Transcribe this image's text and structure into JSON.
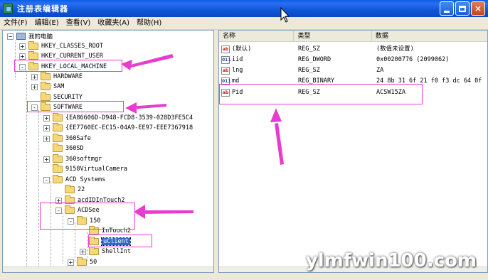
{
  "window": {
    "title": "注册表编辑器",
    "buttons": {
      "minimize": "",
      "maximize": "",
      "close": "×"
    }
  },
  "menu": [
    {
      "label": "文件(F)"
    },
    {
      "label": "编辑(E)"
    },
    {
      "label": "查看(V)"
    },
    {
      "label": "收藏夹(A)"
    },
    {
      "label": "帮助(H)"
    }
  ],
  "tree": {
    "root": "我的电脑",
    "nodes": [
      {
        "label": "HKEY_CLASSES_ROOT",
        "expander": "+"
      },
      {
        "label": "HKEY_CURRENT_USER",
        "expander": "+"
      },
      {
        "label": "HKEY_LOCAL_MACHINE",
        "expander": "-"
      },
      {
        "label": "HARDWARE",
        "expander": "+"
      },
      {
        "label": "SAM",
        "expander": "+"
      },
      {
        "label": "SECURITY",
        "expander": ""
      },
      {
        "label": "SOFTWARE",
        "expander": "-"
      },
      {
        "label": "{EA86606D-D948-FCD8-3539-028D3FE5C4",
        "expander": "+"
      },
      {
        "label": "{EE7760EC-EC15-04A9-EE97-EEE7367918",
        "expander": "+"
      },
      {
        "label": "360Safe",
        "expander": "+"
      },
      {
        "label": "360SD",
        "expander": ""
      },
      {
        "label": "360softmgr",
        "expander": "+"
      },
      {
        "label": "9158VirtualCamera",
        "expander": ""
      },
      {
        "label": "ACD Systems",
        "expander": "-"
      },
      {
        "label": "22",
        "expander": ""
      },
      {
        "label": "acdIDInTouch2",
        "expander": "+"
      },
      {
        "label": "ACDSee",
        "expander": "-"
      },
      {
        "label": "150",
        "expander": "-"
      },
      {
        "label": "InTouch2",
        "expander": ""
      },
      {
        "label": "uClient",
        "expander": ""
      },
      {
        "label": "ShellInt",
        "expander": "+"
      },
      {
        "label": "50",
        "expander": "+"
      }
    ]
  },
  "list": {
    "headers": {
      "name": "名称",
      "type": "类型",
      "data": "数据"
    },
    "rows": [
      {
        "icon": "ab",
        "name": "(默认)",
        "type": "REG_SZ",
        "data": "(数值未设置)"
      },
      {
        "icon": "011",
        "name": "iid",
        "type": "REG_DWORD",
        "data": "0x00200776 (2099062)"
      },
      {
        "icon": "ab",
        "name": "lng",
        "type": "REG_SZ",
        "data": "ZA"
      },
      {
        "icon": "011",
        "name": "md",
        "type": "REG_BINARY",
        "data": "24 8b 31 6f 21 f0 f3 dc 64 0f"
      },
      {
        "icon": "ab",
        "name": "Pid",
        "type": "REG_SZ",
        "data": "ACSW15ZA"
      }
    ]
  },
  "watermark": "ylmfwin100.com",
  "colors": {
    "annotation": "#e83ccf",
    "selection": "#316AC5",
    "titlebar": "#0A5FE8"
  }
}
